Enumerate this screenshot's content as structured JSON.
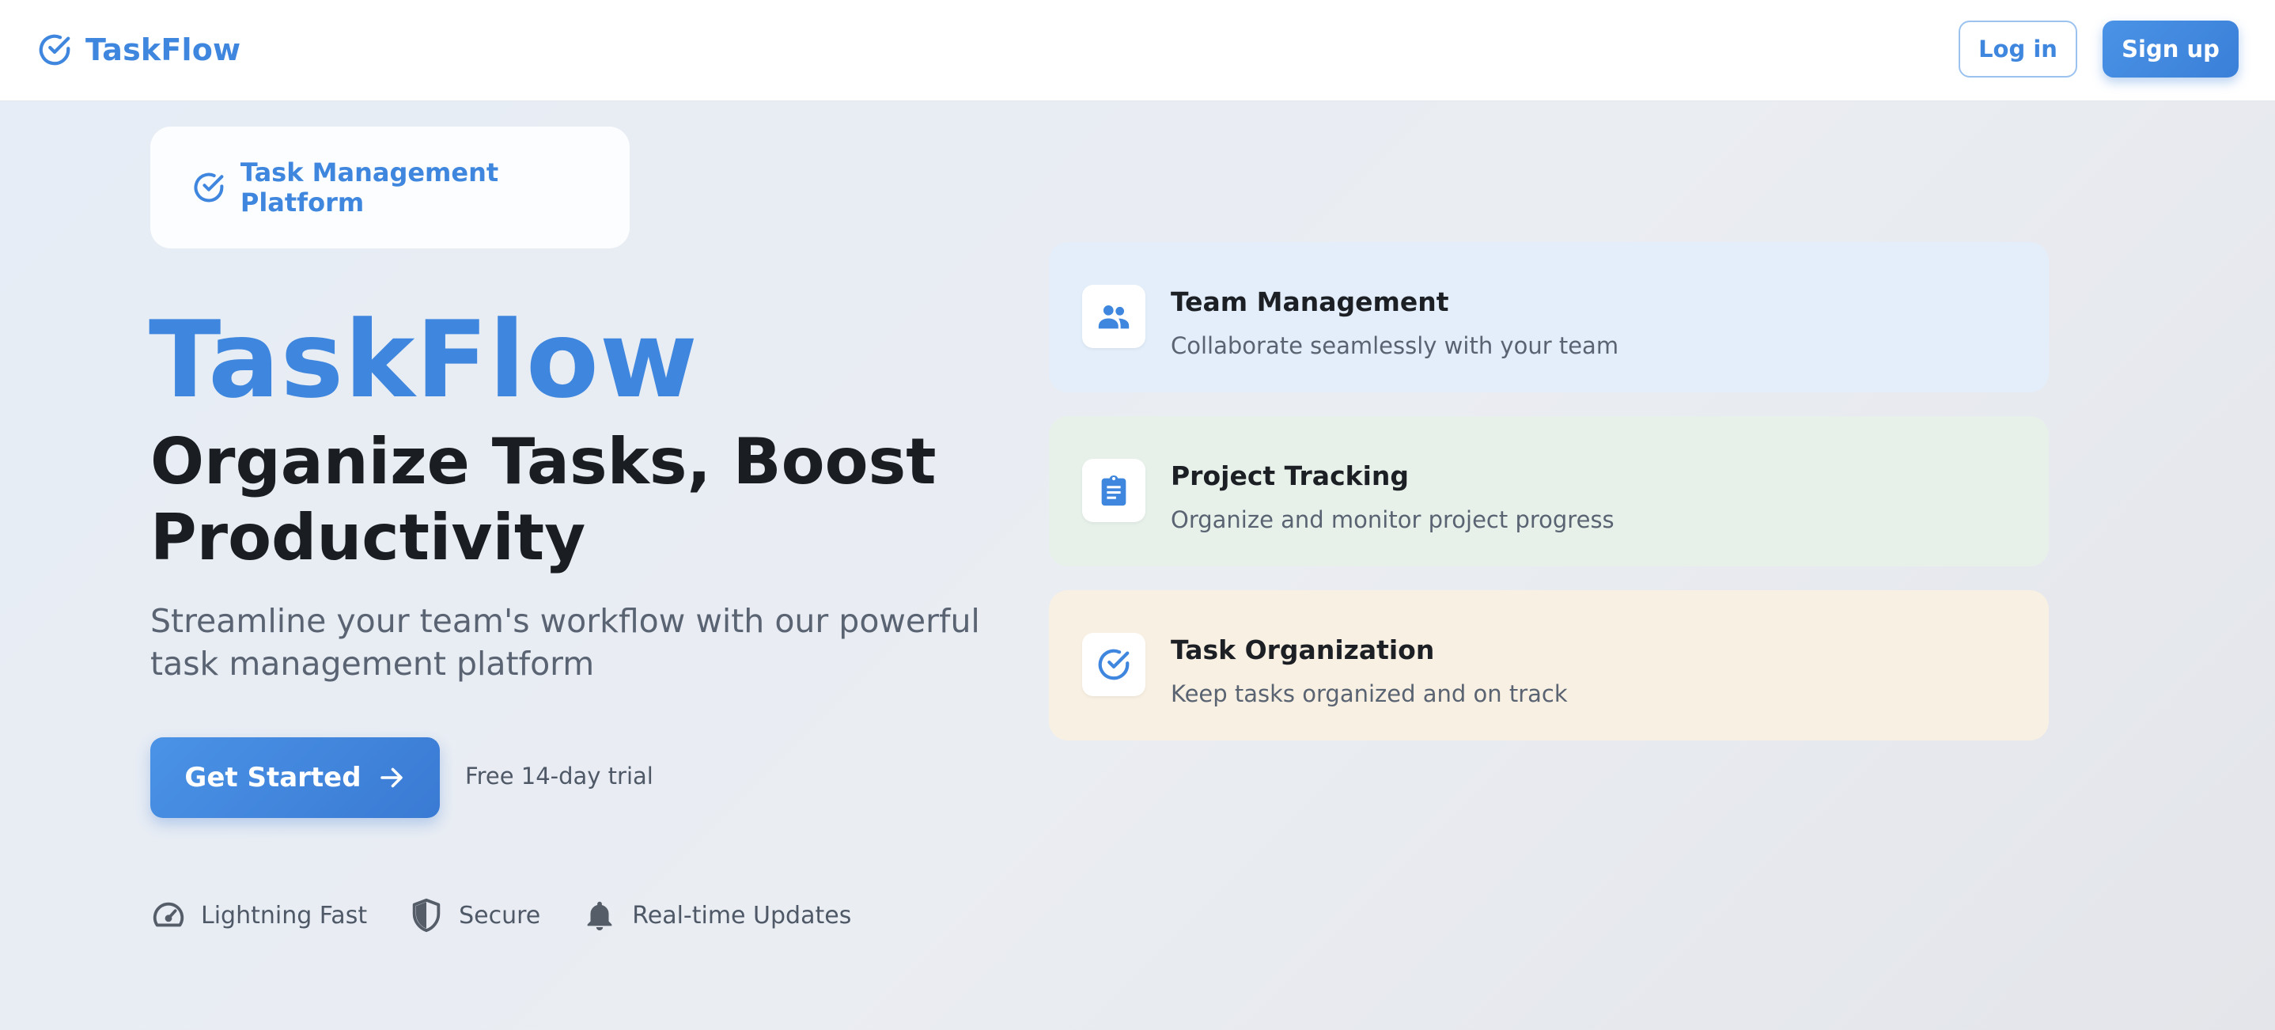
{
  "header": {
    "brand": "TaskFlow",
    "brand_icon": "check-circle-icon",
    "login_label": "Log in",
    "signup_label": "Sign up"
  },
  "badge": {
    "icon": "check-circle-icon",
    "label": "Task Management Platform"
  },
  "hero": {
    "brand": "TaskFlow",
    "headline": "Organize Tasks, Boost Productivity",
    "subtitle": "Streamline your team's workflow with our powerful task management platform",
    "cta_label": "Get Started",
    "cta_icon": "arrow-right-icon",
    "trial_text": "Free 14-day trial"
  },
  "features": [
    {
      "icon": "speedometer-icon",
      "label": "Lightning Fast"
    },
    {
      "icon": "shield-icon",
      "label": "Secure"
    },
    {
      "icon": "bell-icon",
      "label": "Real-time Updates"
    }
  ],
  "cards": [
    {
      "icon": "team-icon",
      "title": "Team Management",
      "description": "Collaborate seamlessly with your team",
      "bg": "#e3eefa"
    },
    {
      "icon": "clipboard-icon",
      "title": "Project Tracking",
      "description": "Organize and monitor project progress",
      "bg": "#e7f1ea"
    },
    {
      "icon": "check-circle-icon",
      "title": "Task Organization",
      "description": "Keep tasks organized and on track",
      "bg": "#f8f0e2"
    }
  ],
  "colors": {
    "accent": "#3f86de",
    "heading": "#1a1d22",
    "muted": "#596372"
  }
}
